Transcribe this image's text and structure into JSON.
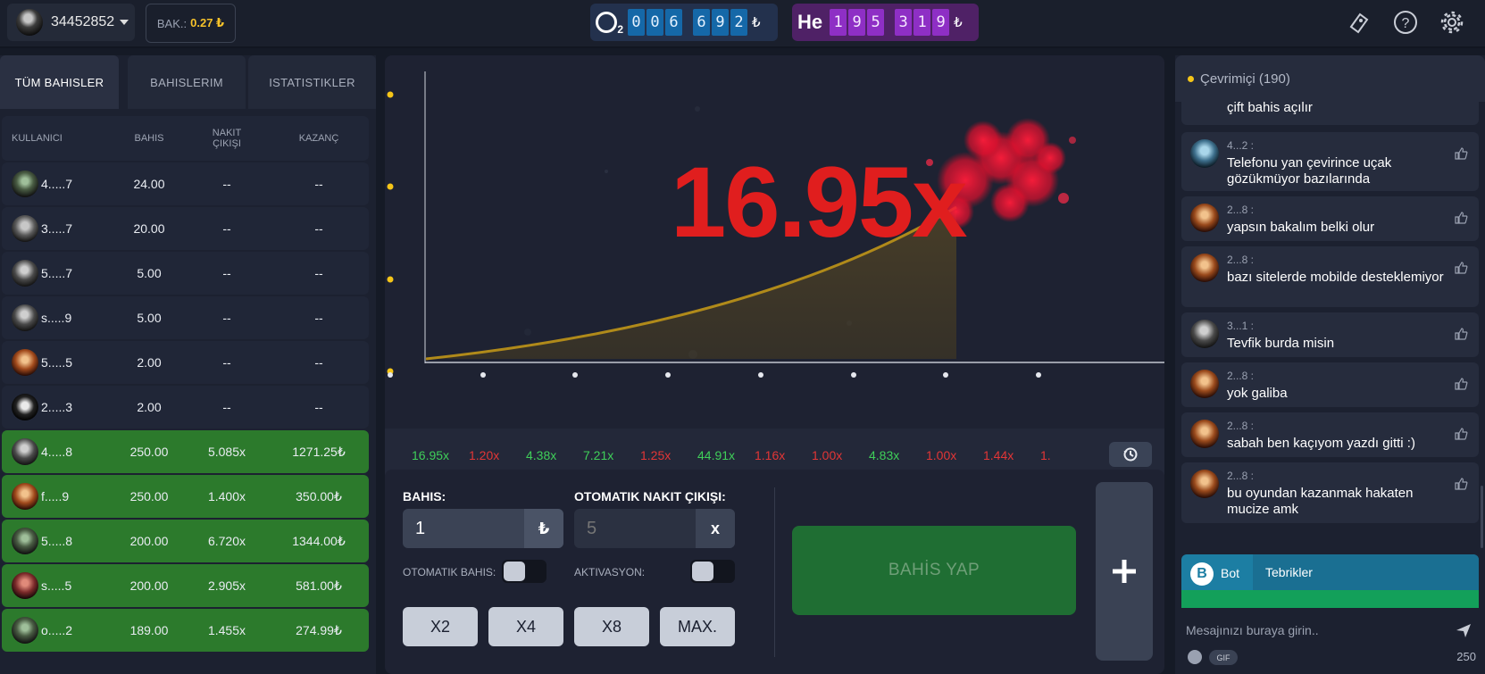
{
  "header": {
    "user_id": "34452852",
    "balance_label": "BAK.:",
    "balance_value": "0.27 ₺",
    "o2_label": "O₂",
    "o2_digits": [
      "0",
      "0",
      "6",
      "6",
      "9",
      "2"
    ],
    "he_label": "He",
    "he_digits": [
      "1",
      "9",
      "5",
      "3",
      "1",
      "9"
    ],
    "currency": "₺"
  },
  "tabs": [
    {
      "label": "TÜM BAHISLER",
      "active": true
    },
    {
      "label": "BAHISLERIM",
      "active": false
    },
    {
      "label": "ISTATISTIKLER",
      "active": false
    }
  ],
  "table": {
    "headers": {
      "user": "KULLANICI",
      "bet": "BAHIS",
      "cashout": "NAKIT ÇIKIŞI",
      "win": "KAZANÇ"
    },
    "rows": [
      {
        "user": "4.....7",
        "bet": "24.00",
        "cashout": "--",
        "win": "--",
        "won": false,
        "ava": "a1"
      },
      {
        "user": "3.....7",
        "bet": "20.00",
        "cashout": "--",
        "win": "--",
        "won": false,
        "ava": "a2"
      },
      {
        "user": "5.....7",
        "bet": "5.00",
        "cashout": "--",
        "win": "--",
        "won": false,
        "ava": "a3"
      },
      {
        "user": "s.....9",
        "bet": "5.00",
        "cashout": "--",
        "win": "--",
        "won": false,
        "ava": "a3"
      },
      {
        "user": "5.....5",
        "bet": "2.00",
        "cashout": "--",
        "win": "--",
        "won": false,
        "ava": "a4"
      },
      {
        "user": "2.....3",
        "bet": "2.00",
        "cashout": "--",
        "win": "--",
        "won": false,
        "ava": "a5"
      },
      {
        "user": "4.....8",
        "bet": "250.00",
        "cashout": "5.085x",
        "win": "1271.25₺",
        "won": true,
        "ava": "a3"
      },
      {
        "user": "f.....9",
        "bet": "250.00",
        "cashout": "1.400x",
        "win": "350.00₺",
        "won": true,
        "ava": "a4"
      },
      {
        "user": "5.....8",
        "bet": "200.00",
        "cashout": "6.720x",
        "win": "1344.00₺",
        "won": true,
        "ava": "a1"
      },
      {
        "user": "s.....5",
        "bet": "200.00",
        "cashout": "2.905x",
        "win": "581.00₺",
        "won": true,
        "ava": "a6"
      },
      {
        "user": "o.....2",
        "bet": "189.00",
        "cashout": "1.455x",
        "win": "274.99₺",
        "won": true,
        "ava": "a1"
      }
    ]
  },
  "game": {
    "multiplier": "16.95x",
    "multiplier_color": "#e01e1e",
    "history": [
      {
        "value": "16.95x",
        "color": "#3fcf59"
      },
      {
        "value": "1.20x",
        "color": "#e23636"
      },
      {
        "value": "4.38x",
        "color": "#3fcf59"
      },
      {
        "value": "7.21x",
        "color": "#3fcf59"
      },
      {
        "value": "1.25x",
        "color": "#e23636"
      },
      {
        "value": "44.91x",
        "color": "#3fcf59"
      },
      {
        "value": "1.16x",
        "color": "#e23636"
      },
      {
        "value": "1.00x",
        "color": "#e23636"
      },
      {
        "value": "4.83x",
        "color": "#3fcf59"
      },
      {
        "value": "1.00x",
        "color": "#e23636"
      },
      {
        "value": "1.44x",
        "color": "#e23636"
      },
      {
        "value": "1.",
        "color": "#e23636"
      }
    ]
  },
  "bet": {
    "bet_label": "BAHIS:",
    "bet_value": "1",
    "bet_suffix": "₺",
    "auto_cashout_label": "OTOMATIK NAKIT ÇIKIŞI:",
    "auto_cashout_placeholder": "5",
    "auto_cashout_suffix": "x",
    "auto_bet_label": "OTOMATIK BAHIS:",
    "activation_label": "AKTIVASYON:",
    "quick_buttons": [
      "X2",
      "X4",
      "X8",
      "MAX."
    ],
    "place_bet_label": "BAHİS YAP",
    "plus_label": "+"
  },
  "chat": {
    "online_label": "Çevrimiçi (190)",
    "partial_top": "çift bahis açılır",
    "messages": [
      {
        "name": "4...2 :",
        "text": "Telefonu yan çevirince uçak gözükmüyor bazılarında",
        "ava": "m1"
      },
      {
        "name": "2...8 :",
        "text": "yapsın bakalım belki olur",
        "ava": "m2"
      },
      {
        "name": "2...8 :",
        "text": "bazı sitelerde mobilde desteklemiyor",
        "ava": "m2"
      },
      {
        "name": "3...1 :",
        "text": "Tevfik burda misin",
        "ava": "m3"
      },
      {
        "name": "2...8 :",
        "text": "yok galiba",
        "ava": "m2"
      },
      {
        "name": "2...8 :",
        "text": "sabah ben kaçıyom yazdı gitti :)",
        "ava": "m2"
      },
      {
        "name": "2...8 :",
        "text": "bu oyundan kazanmak hakaten mucize amk",
        "ava": "m2"
      }
    ],
    "bot_badge": "B",
    "bot_name": "Bot",
    "bot_text": "Tebrikler",
    "input_placeholder": "Mesajınızı buraya girin..",
    "gif_label": "GIF",
    "char_count": "250"
  }
}
